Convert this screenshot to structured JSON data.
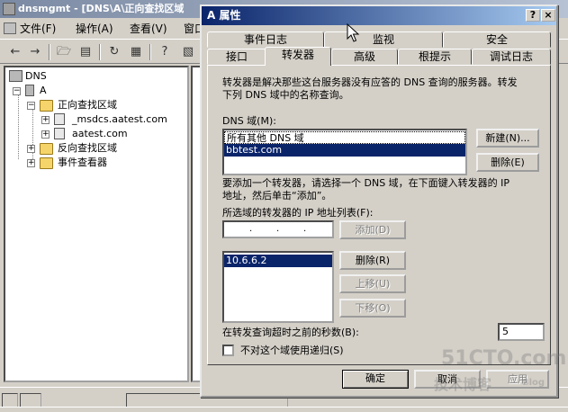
{
  "mmc": {
    "title": "dnsmgmt - [DNS\\A\\正向查找区域",
    "menu": [
      "文件(F)",
      "操作(A)",
      "查看(V)",
      "窗口"
    ],
    "toolbar_icons": [
      "back-arrow-icon",
      "forward-arrow-icon",
      "up-folder-icon",
      "show-tree-icon",
      "refresh-icon",
      "export-icon",
      "help-icon",
      "properties-icon"
    ],
    "tree": {
      "root": "DNS",
      "server": "A",
      "forward_zones": "正向查找区域",
      "zone_msdcs": "_msdcs.aatest.com",
      "zone_aatest": "aatest.com",
      "reverse_zones": "反向查找区域",
      "event_viewer": "事件查看器"
    }
  },
  "dialog": {
    "title": "A 属性",
    "title_buttons": {
      "help": "?",
      "close": "×"
    },
    "tabs_row1": [
      "事件日志",
      "监视",
      "安全"
    ],
    "tabs_row2": [
      "接口",
      "转发器",
      "高级",
      "根提示",
      "调试日志"
    ],
    "active_tab": "转发器",
    "description": [
      "转发器是解决那些这台服务器没有应答的 DNS 查询的服务器。转发",
      "下列 DNS 域中的名称查询。"
    ],
    "dns_domain_label": "DNS 域(M):",
    "dns_domains": [
      "所有其他 DNS 域",
      "bbtest.com"
    ],
    "selected_domain": "bbtest.com",
    "new_button": "新建(N)...",
    "delete_domain_button": "删除(E)",
    "add_hint": [
      "要添加一个转发器，请选择一个 DNS 域，在下面键入转发器的 IP",
      "地址，然后单击“添加”。"
    ],
    "ip_list_label": "所选域的转发器的 IP 地址列表(F):",
    "ip_input_dots": [
      ".",
      ".",
      "."
    ],
    "add_button": "添加(D)",
    "forwarders": [
      "10.6.6.2"
    ],
    "delete_ip_button": "删除(R)",
    "move_up_button": "上移(U)",
    "move_down_button": "下移(O)",
    "timeout_label": "在转发查询超时之前的秒数(B):",
    "timeout_value": "5",
    "no_recursion_label": "不对这个域使用递归(S)",
    "ok_button": "确定",
    "cancel_button": "取消",
    "apply_button": "应用"
  },
  "watermark": {
    "line1": "51CTO.com",
    "line2": "技术博客",
    "line3": "Blog"
  }
}
